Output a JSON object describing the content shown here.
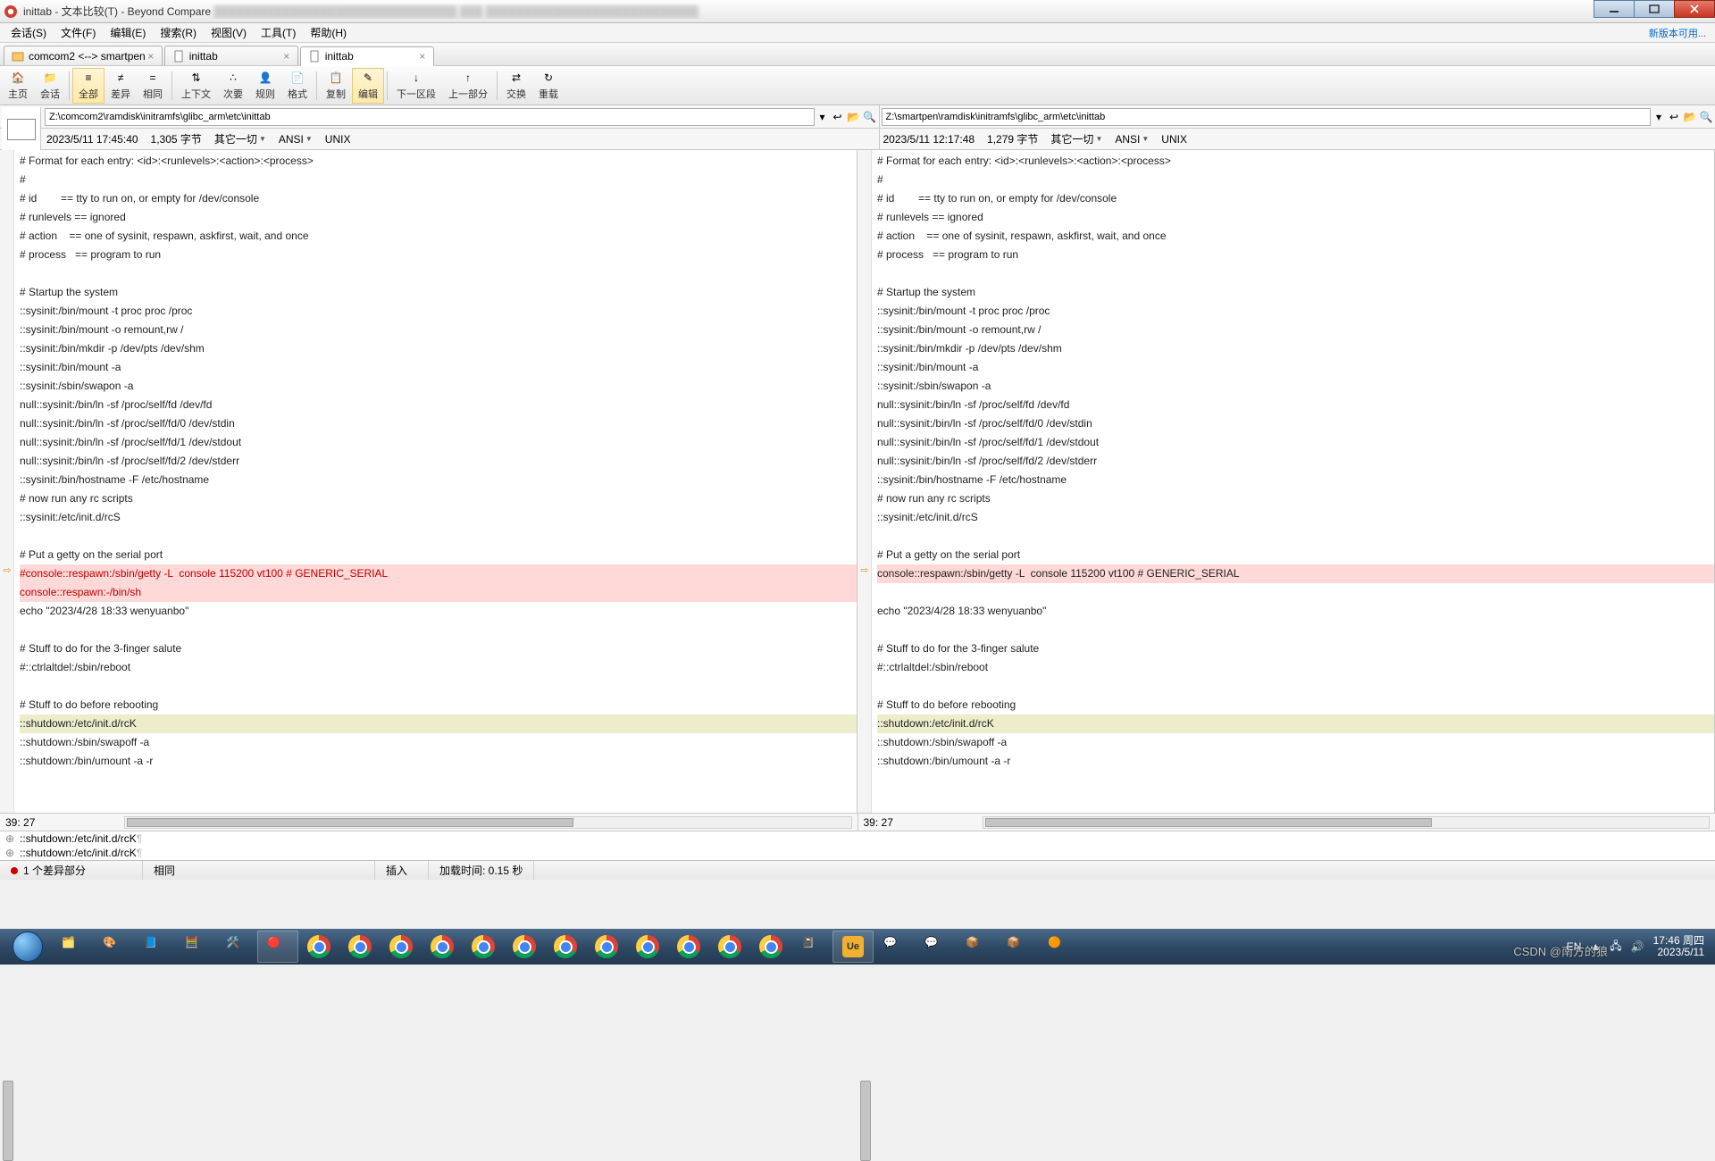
{
  "titlebar": {
    "app_icon": "beyond-compare",
    "title_prefix": "inittab - 文本比较(T) - Beyond Compare"
  },
  "menu": {
    "session": "会话(S)",
    "file": "文件(F)",
    "edit": "编辑(E)",
    "search": "搜索(R)",
    "view": "视图(V)",
    "tools": "工具(T)",
    "help": "帮助(H)",
    "updates": "新版本可用..."
  },
  "tabs": [
    {
      "label": "comcom2 <--> smartpen",
      "icon": "folder-compare",
      "active": false
    },
    {
      "label": "inittab",
      "icon": "file",
      "active": false
    },
    {
      "label": "inittab",
      "icon": "file",
      "active": true
    }
  ],
  "toolbar": {
    "home": "主页",
    "session": "会话",
    "all": "全部",
    "diff": "差异",
    "same": "相同",
    "context": "上下文",
    "next": "次要",
    "rules": "规则",
    "format": "格式",
    "copy": "复制",
    "edit": "编辑",
    "next_section": "下一区段",
    "prev_section": "上一部分",
    "swap": "交换",
    "reload": "重载"
  },
  "left": {
    "path": "Z:\\comcom2\\ramdisk\\initramfs\\glibc_arm\\etc\\inittab",
    "timestamp": "2023/5/11 17:45:40",
    "size": "1,305 字节",
    "everything": "其它一切",
    "encoding": "ANSI",
    "lineend": "UNIX",
    "cursor": "39: 27",
    "lines": [
      "# Format for each entry: <id>:<runlevels>:<action>:<process>",
      "#",
      "# id        == tty to run on, or empty for /dev/console",
      "# runlevels == ignored",
      "# action    == one of sysinit, respawn, askfirst, wait, and once",
      "# process   == program to run",
      "",
      "# Startup the system",
      "::sysinit:/bin/mount -t proc proc /proc",
      "::sysinit:/bin/mount -o remount,rw /",
      "::sysinit:/bin/mkdir -p /dev/pts /dev/shm",
      "::sysinit:/bin/mount -a",
      "::sysinit:/sbin/swapon -a",
      "null::sysinit:/bin/ln -sf /proc/self/fd /dev/fd",
      "null::sysinit:/bin/ln -sf /proc/self/fd/0 /dev/stdin",
      "null::sysinit:/bin/ln -sf /proc/self/fd/1 /dev/stdout",
      "null::sysinit:/bin/ln -sf /proc/self/fd/2 /dev/stderr",
      "::sysinit:/bin/hostname -F /etc/hostname",
      "# now run any rc scripts",
      "::sysinit:/etc/init.d/rcS",
      "",
      "# Put a getty on the serial port",
      "#console::respawn:/sbin/getty -L  console 115200 vt100 # GENERIC_SERIAL",
      "console::respawn:-/bin/sh",
      "echo \"2023/4/28 18:33 wenyuanbo\"",
      "",
      "# Stuff to do for the 3-finger salute",
      "#::ctrlaltdel:/sbin/reboot",
      "",
      "# Stuff to do before rebooting",
      "::shutdown:/etc/init.d/rcK",
      "::shutdown:/sbin/swapoff -a",
      "::shutdown:/bin/umount -a -r"
    ],
    "diff_index": 22,
    "extra_index": 23,
    "cur_index": 30
  },
  "right": {
    "path": "Z:\\smartpen\\ramdisk\\initramfs\\glibc_arm\\etc\\inittab",
    "timestamp": "2023/5/11 12:17:48",
    "size": "1,279 字节",
    "everything": "其它一切",
    "encoding": "ANSI",
    "lineend": "UNIX",
    "cursor": "39: 27",
    "lines": [
      "# Format for each entry: <id>:<runlevels>:<action>:<process>",
      "#",
      "# id        == tty to run on, or empty for /dev/console",
      "# runlevels == ignored",
      "# action    == one of sysinit, respawn, askfirst, wait, and once",
      "# process   == program to run",
      "",
      "# Startup the system",
      "::sysinit:/bin/mount -t proc proc /proc",
      "::sysinit:/bin/mount -o remount,rw /",
      "::sysinit:/bin/mkdir -p /dev/pts /dev/shm",
      "::sysinit:/bin/mount -a",
      "::sysinit:/sbin/swapon -a",
      "null::sysinit:/bin/ln -sf /proc/self/fd /dev/fd",
      "null::sysinit:/bin/ln -sf /proc/self/fd/0 /dev/stdin",
      "null::sysinit:/bin/ln -sf /proc/self/fd/1 /dev/stdout",
      "null::sysinit:/bin/ln -sf /proc/self/fd/2 /dev/stderr",
      "::sysinit:/bin/hostname -F /etc/hostname",
      "# now run any rc scripts",
      "::sysinit:/etc/init.d/rcS",
      "",
      "# Put a getty on the serial port",
      "console::respawn:/sbin/getty -L  console 115200 vt100 # GENERIC_SERIAL",
      "",
      "echo \"2023/4/28 18:33 wenyuanbo\"",
      "",
      "# Stuff to do for the 3-finger salute",
      "#::ctrlaltdel:/sbin/reboot",
      "",
      "# Stuff to do before rebooting",
      "::shutdown:/etc/init.d/rcK",
      "::shutdown:/sbin/swapoff -a",
      "::shutdown:/bin/umount -a -r"
    ],
    "diff_index": 22,
    "cur_index": 30
  },
  "merge": {
    "line1": "::shutdown:/etc/init.d/rcK",
    "line2": "::shutdown:/etc/init.d/rcK"
  },
  "status": {
    "diff_count": "1 个差异部分",
    "same": "相同",
    "insert": "插入",
    "load": "加载时间: 0.15 秒"
  },
  "tray": {
    "ime": "EN",
    "time": "17:46 周四",
    "date": "2023/5/11"
  },
  "watermark": "CSDN @南方的狼"
}
